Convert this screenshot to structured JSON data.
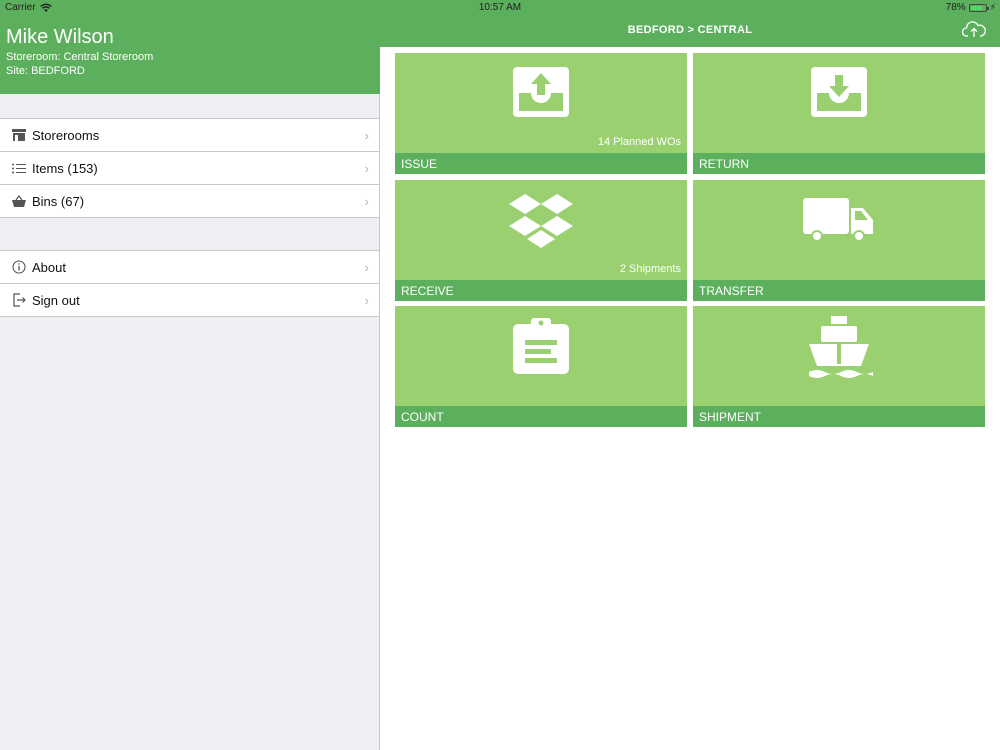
{
  "status_bar": {
    "carrier": "Carrier",
    "time": "10:57 AM",
    "battery": "78%",
    "battery_level": 0.78
  },
  "profile": {
    "name": "Mike Wilson",
    "storeroom": "Storeroom: Central Storeroom",
    "site": "Site: BEDFORD"
  },
  "menu": {
    "group1": [
      {
        "label": "Storerooms",
        "icon": "storeroom-icon"
      },
      {
        "label": "Items (153)",
        "icon": "list-icon"
      },
      {
        "label": "Bins (67)",
        "icon": "basket-icon"
      }
    ],
    "group2": [
      {
        "label": "About",
        "icon": "info-icon"
      },
      {
        "label": "Sign out",
        "icon": "sign-out-icon"
      }
    ]
  },
  "header": {
    "title": "BEDFORD > CENTRAL",
    "sync_icon": "cloud-upload-icon"
  },
  "tiles": [
    {
      "label": "ISSUE",
      "sub": "14 Planned WOs",
      "icon": "issue-tray-icon"
    },
    {
      "label": "RETURN",
      "sub": "",
      "icon": "return-tray-icon"
    },
    {
      "label": "RECEIVE",
      "sub": "2 Shipments",
      "icon": "boxes-icon"
    },
    {
      "label": "TRANSFER",
      "sub": "",
      "icon": "truck-icon"
    },
    {
      "label": "COUNT",
      "sub": "",
      "icon": "clipboard-icon"
    },
    {
      "label": "SHIPMENT",
      "sub": "",
      "icon": "ship-icon"
    }
  ],
  "colors": {
    "header_green": "#5caf5c",
    "tile_green": "#9ad070",
    "sidebar_bg": "#efeff4"
  }
}
